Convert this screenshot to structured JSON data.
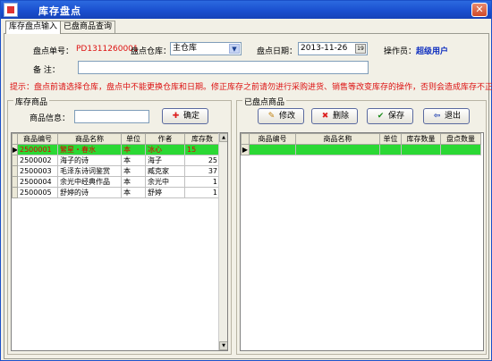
{
  "window": {
    "title": "库存盘点",
    "close_symbol": "✕"
  },
  "tabs": [
    {
      "label": "库存盘点输入"
    },
    {
      "label": "已盘商品查询"
    }
  ],
  "form": {
    "order_no_label": "盘点单号：",
    "order_no_value": "PD1311260001",
    "warehouse_label": "盘点仓库：",
    "warehouse_value": "主仓库",
    "date_label": "盘点日期：",
    "date_value": "2013-11-26",
    "operator_label": "操作员：",
    "operator_value": "超级用户",
    "remark_label": "备   注：",
    "remark_value": "",
    "hint": "提示：盘点前请选择仓库，盘点中不能更换仓库和日期。修正库存之前请勿进行采购进货、销售等改变库存的操作，否则会造成库存不正确。"
  },
  "inventory": {
    "group_title": "库存商品",
    "search_label": "商品信息：",
    "search_value": "",
    "confirm_label": "确定",
    "columns": [
      "商品编号",
      "商品名称",
      "单位",
      "作者",
      "库存数"
    ],
    "rows": [
      [
        "2500001",
        "繁星・春水",
        "本",
        "冰心",
        "15"
      ],
      [
        "2500002",
        "海子的诗",
        "本",
        "海子",
        "25"
      ],
      [
        "2500003",
        "毛泽东诗词鉴赏",
        "本",
        "臧克家",
        "37"
      ],
      [
        "2500004",
        "余光中经典作品",
        "本",
        "余光中",
        "1"
      ],
      [
        "2500005",
        "舒婷的诗",
        "本",
        "舒婷",
        "1"
      ]
    ]
  },
  "counted": {
    "group_title": "已盘点商品",
    "edit_label": "修改",
    "delete_label": "删除",
    "save_label": "保存",
    "exit_label": "退出",
    "columns": [
      "商品编号",
      "商品名称",
      "单位",
      "库存数量",
      "盘点数量"
    ]
  },
  "colors": {
    "title_bar": "#1a4fcf",
    "selected_row": "#2bd834",
    "hint_text": "#dd1111",
    "operator": "#1030c0"
  }
}
